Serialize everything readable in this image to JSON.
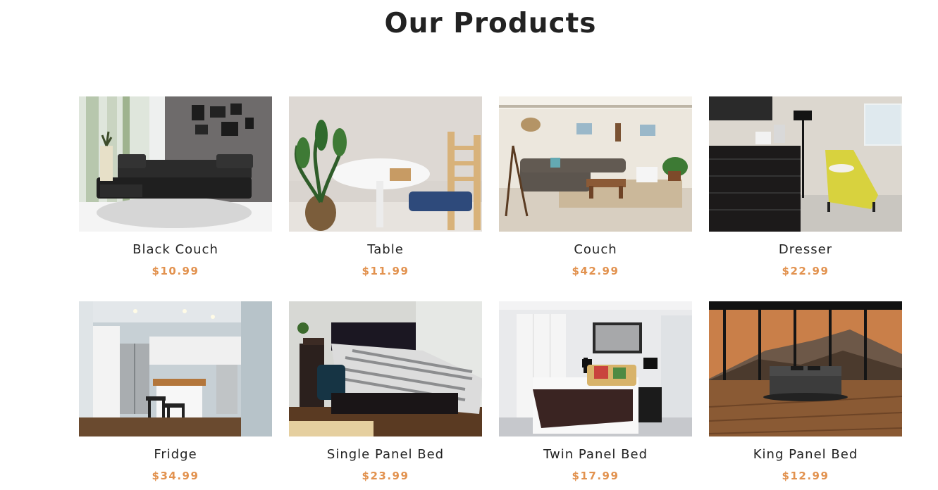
{
  "section": {
    "title": "Our Products"
  },
  "products": [
    {
      "name": "Black Couch",
      "price": "$10.99"
    },
    {
      "name": "Table",
      "price": "$11.99"
    },
    {
      "name": "Couch",
      "price": "$42.99"
    },
    {
      "name": "Dresser",
      "price": "$22.99"
    },
    {
      "name": "Fridge",
      "price": "$34.99"
    },
    {
      "name": "Single Panel Bed",
      "price": "$23.99"
    },
    {
      "name": "Twin Panel Bed",
      "price": "$17.99"
    },
    {
      "name": "King Panel Bed",
      "price": "$12.99"
    }
  ],
  "colors": {
    "title": "#222222",
    "price": "#e2924f",
    "background": "#ffffff"
  }
}
